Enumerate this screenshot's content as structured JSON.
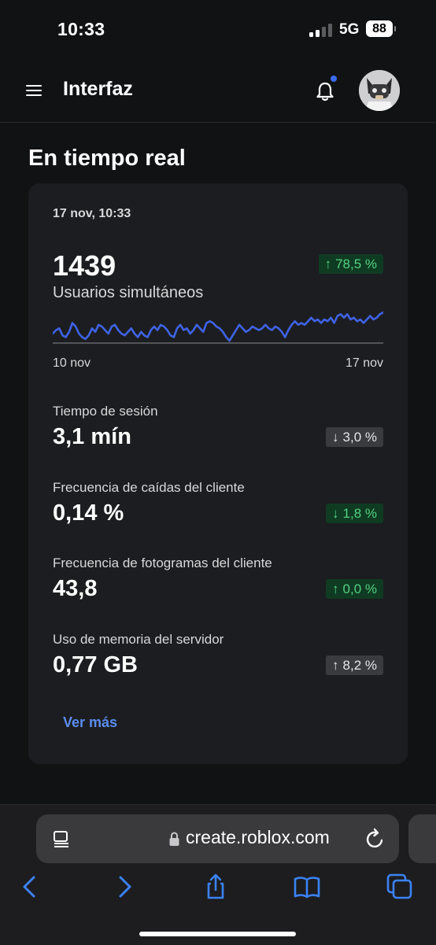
{
  "status_bar": {
    "time": "10:33",
    "network": "5G",
    "battery": "88"
  },
  "header": {
    "title": "Interfaz"
  },
  "section": {
    "title": "En tiempo real"
  },
  "card": {
    "date": "17 nov, 10:33",
    "main_value": "1439",
    "main_label": "Usuarios simultáneos",
    "main_change": {
      "arrow": "↑",
      "text": "78,5 %"
    },
    "chart_start": "10 nov",
    "chart_end": "17 nov",
    "metrics": [
      {
        "label": "Tiempo de sesión",
        "value": "3,1 mín",
        "arrow": "↓",
        "change": "3,0 %",
        "tone": "gray"
      },
      {
        "label": "Frecuencia de caídas del cliente",
        "value": "0,14 %",
        "arrow": "↓",
        "change": "1,8 %",
        "tone": "green"
      },
      {
        "label": "Frecuencia de fotogramas del cliente",
        "value": "43,8",
        "arrow": "↑",
        "change": "0,0 %",
        "tone": "green"
      },
      {
        "label": "Uso de memoria del servidor",
        "value": "0,77 GB",
        "arrow": "↑",
        "change": "8,2 %",
        "tone": "gray"
      }
    ],
    "more_link": "Ver más"
  },
  "browser": {
    "url": "create.roblox.com"
  },
  "chart_data": {
    "type": "line",
    "x": [
      "10 nov",
      "17 nov"
    ],
    "series": [
      {
        "values": [
          22,
          24,
          25,
          21,
          20,
          23,
          28,
          26,
          22,
          20,
          19,
          21,
          25,
          23,
          27,
          26,
          24,
          22,
          26,
          27,
          24,
          22,
          21,
          23,
          25,
          22,
          20,
          23,
          21,
          20,
          24,
          26,
          24,
          27,
          26,
          24,
          21,
          20,
          25,
          27,
          24,
          25,
          22,
          24,
          27,
          25,
          23,
          28,
          29,
          28,
          26,
          25,
          23,
          20,
          18,
          21,
          24,
          27,
          25,
          23,
          24,
          26,
          25,
          24,
          25,
          27,
          25,
          24,
          26,
          25,
          23,
          20,
          24,
          27,
          29,
          27,
          28,
          27,
          29,
          31,
          29,
          30,
          28,
          30,
          29,
          31,
          28,
          32,
          33,
          31,
          33,
          30,
          31,
          29,
          30,
          28,
          30,
          32,
          30,
          31,
          33,
          34
        ]
      }
    ],
    "line_color": "#3f63e6",
    "axis_labels_shown": [
      "10 nov",
      "17 nov"
    ]
  }
}
